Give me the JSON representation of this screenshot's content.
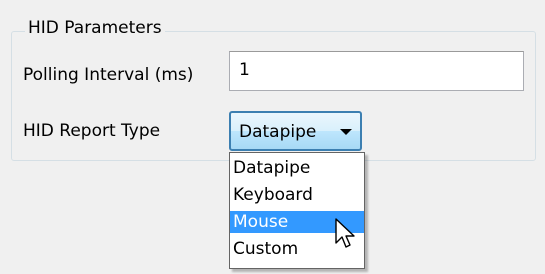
{
  "groupbox": {
    "title": "HID Parameters"
  },
  "polling": {
    "label": "Polling Interval (ms)",
    "value": "1"
  },
  "report_type": {
    "label": "HID Report Type",
    "selected": "Datapipe",
    "options": [
      {
        "label": "Datapipe",
        "highlighted": false
      },
      {
        "label": "Keyboard",
        "highlighted": false
      },
      {
        "label": "Mouse",
        "highlighted": true
      },
      {
        "label": "Custom",
        "highlighted": false
      }
    ]
  },
  "colors": {
    "highlight": "#3399ff",
    "combo_border": "#3c7fb1"
  },
  "icons": {
    "dropdown_arrow": "chevron-down-icon",
    "cursor": "mouse-pointer-icon"
  }
}
